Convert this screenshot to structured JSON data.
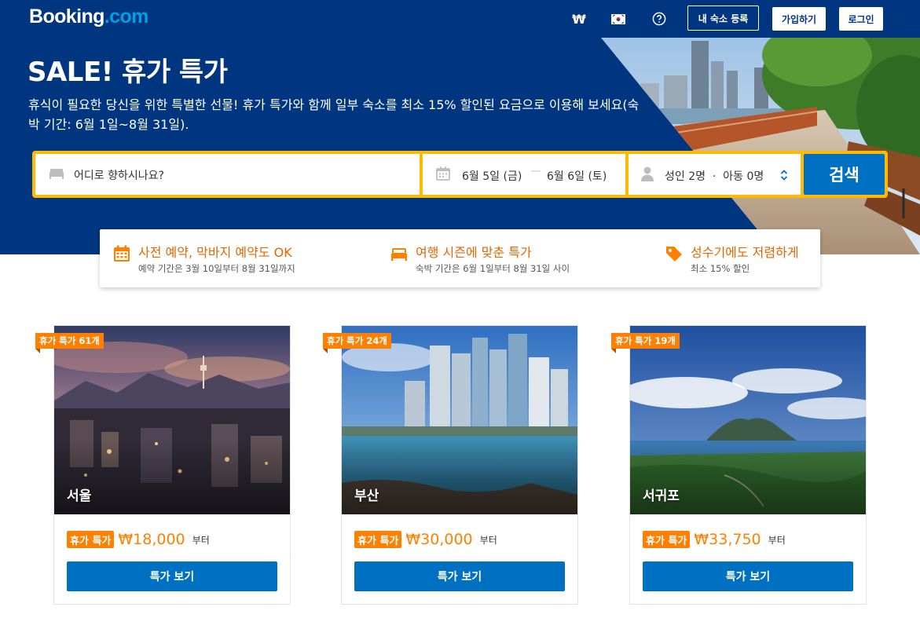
{
  "header": {
    "logo_main": "Booking",
    "logo_suffix": ".com",
    "currency": "₩",
    "flag_icon": "korea-flag-icon",
    "help_icon": "question-circle-icon",
    "list_property": "내 숙소 등록",
    "signup": "가입하기",
    "login": "로그인"
  },
  "hero": {
    "title": "SALE! 휴가 특가",
    "subtitle": "휴식이 필요한 당신을 위한 특별한 선물! 휴가 특가와 함께 일부 숙소를 최소 15% 할인된 요금으로 이용해 보세요(숙박 기간: 6월 1일~8월 31일)."
  },
  "search": {
    "destination_placeholder": "어디로 향하시나요?",
    "checkin": "6월 5일 (금)",
    "separator": "—",
    "checkout": "6월 6일 (토)",
    "guests": "성인 2명  ·  아동 0명",
    "button": "검색"
  },
  "features": [
    {
      "icon": "calendar-icon",
      "title": "사전 예약, 막바지 예약도 OK",
      "desc": "예약 기간은 3월 10일부터 8월 31일까지"
    },
    {
      "icon": "bed-icon",
      "title": "여행 시즌에 맞춘 특가",
      "desc": "숙박 기간은 6월 1일부터 8월 31일 사이"
    },
    {
      "icon": "tag-icon",
      "title": "성수기에도 저렴하게",
      "desc": "최소 15% 할인"
    }
  ],
  "deals": [
    {
      "ribbon": "휴가 특가 61개",
      "city": "서울",
      "badge": "휴가 특가",
      "price": "₩18,000",
      "suffix": "부터",
      "button": "특가 보기"
    },
    {
      "ribbon": "휴가 특가 24개",
      "city": "부산",
      "badge": "휴가 특가",
      "price": "₩30,000",
      "suffix": "부터",
      "button": "특가 보기"
    },
    {
      "ribbon": "휴가 특가 19개",
      "city": "서귀포",
      "badge": "휴가 특가",
      "price": "₩33,750",
      "suffix": "부터",
      "button": "특가 보기"
    }
  ],
  "colors": {
    "brand_blue": "#003580",
    "button_blue": "#0071c2",
    "search_border": "#febb02",
    "deal_orange": "#ff8000",
    "feature_orange": "#e56600"
  }
}
